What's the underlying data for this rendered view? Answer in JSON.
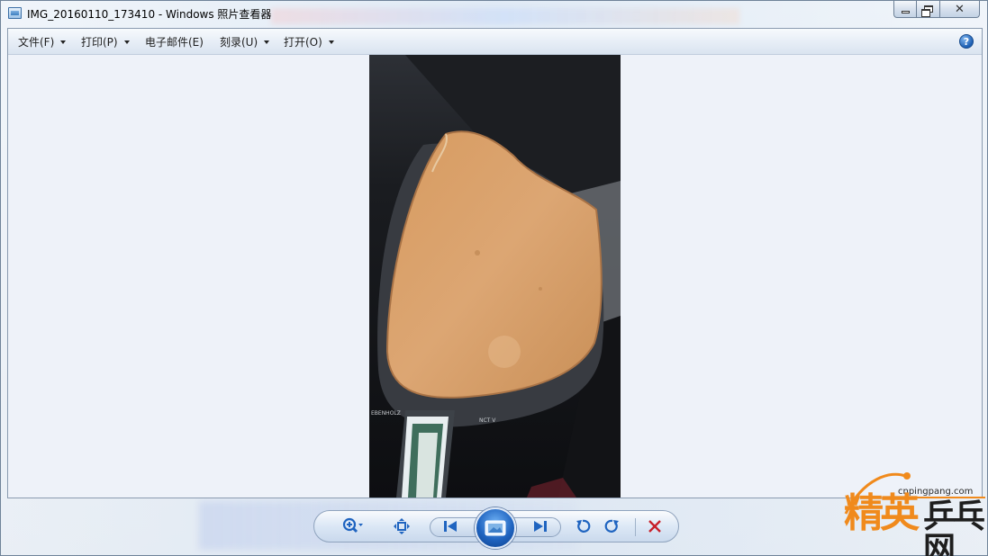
{
  "window": {
    "title": "IMG_20160110_173410 - Windows 照片查看器"
  },
  "menu": {
    "items": [
      {
        "label": "文件(F)",
        "has_dropdown": true
      },
      {
        "label": "打印(P)",
        "has_dropdown": true
      },
      {
        "label": "电子邮件(E)",
        "has_dropdown": false
      },
      {
        "label": "刻录(U)",
        "has_dropdown": true
      },
      {
        "label": "打开(O)",
        "has_dropdown": true
      }
    ],
    "help_label": "?"
  },
  "photo": {
    "subject": "table-tennis-paddle-blade",
    "blade_text_left": "EBENHOLZ",
    "blade_text_right": "NCT V"
  },
  "toolbar": {
    "icons": [
      "zoom-icon",
      "actual-size-icon",
      "previous-icon",
      "slideshow-icon",
      "next-icon",
      "rotate-ccw-icon",
      "rotate-cw-icon",
      "delete-icon"
    ]
  },
  "watermark": {
    "url": "cnpingpang.com",
    "brand_cn_1": "精英",
    "brand_cn_2": "乒乓网"
  },
  "colors": {
    "accent_blue": "#1f64c0",
    "delete_red": "#c8202a",
    "watermark_orange": "#f08a1c"
  }
}
